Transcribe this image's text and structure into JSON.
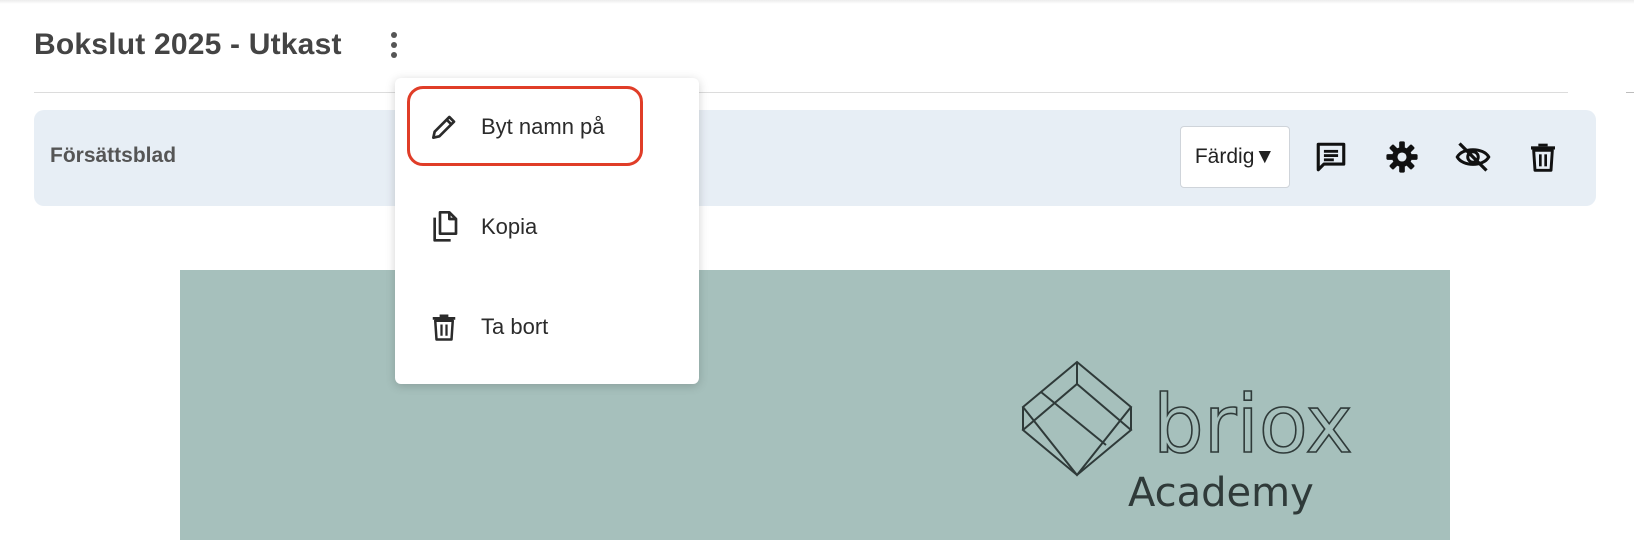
{
  "header": {
    "title": "Bokslut 2025 - Utkast",
    "more_icon": "more-vertical-icon"
  },
  "section": {
    "label": "Försättsblad",
    "status": "Färdig▼",
    "tools": [
      "comment-icon",
      "settings-gear-icon",
      "visibility-off-icon",
      "trash-icon"
    ]
  },
  "context_menu": {
    "highlight_color": "#e03d28",
    "items": [
      {
        "label": "Byt namn på",
        "icon": "pencil-icon"
      },
      {
        "label": "Kopia",
        "icon": "copy-icon"
      },
      {
        "label": "Ta bort",
        "icon": "trash-icon"
      }
    ]
  },
  "preview": {
    "background": "#a6c0bc",
    "logo_text": "briox",
    "logo_subtext": "Academy"
  }
}
